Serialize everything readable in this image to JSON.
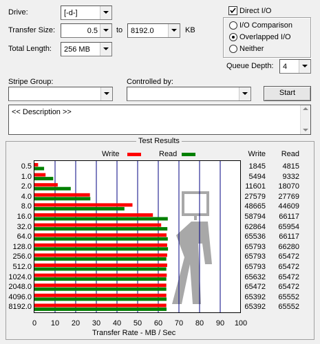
{
  "labels": {
    "drive": "Drive:",
    "transfer_size": "Transfer Size:",
    "to": "to",
    "kb": "KB",
    "total_length": "Total Length:",
    "stripe_group": "Stripe Group:",
    "controlled_by": "Controlled by:",
    "queue_depth": "Queue Depth:",
    "description": "<< Description >>",
    "test_results": "Test Results"
  },
  "fields": {
    "drive": "[-d-]",
    "transfer_size_min": "0.5",
    "transfer_size_max": "8192.0",
    "total_length": "256 MB",
    "stripe_group": "",
    "controlled_by": "",
    "queue_depth": "4"
  },
  "options": {
    "direct_io": "Direct I/O",
    "direct_io_checked": true,
    "io_comparison": "I/O Comparison",
    "overlapped_io": "Overlapped I/O",
    "neither": "Neither",
    "selected": "overlapped_io"
  },
  "buttons": {
    "start": "Start"
  },
  "legend": {
    "write": "Write",
    "read": "Read"
  },
  "columns": {
    "write": "Write",
    "read": "Read"
  },
  "colors": {
    "write": "#ff0000",
    "read": "#008000",
    "grid": "#000080"
  },
  "chart_data": {
    "type": "bar",
    "orientation": "horizontal",
    "title": "Test Results",
    "xlabel": "Transfer Rate - MB / Sec",
    "xlim": [
      0,
      100
    ],
    "xticks": [
      "0",
      "10",
      "20",
      "30",
      "40",
      "50",
      "60",
      "70",
      "80",
      "90",
      "100"
    ],
    "categories": [
      "0.5",
      "1.0",
      "2.0",
      "4.0",
      "8.0",
      "16.0",
      "32.0",
      "64.0",
      "128.0",
      "256.0",
      "512.0",
      "1024.0",
      "2048.0",
      "4096.0",
      "8192.0"
    ],
    "series": [
      {
        "name": "Write",
        "color": "#ff0000",
        "values": [
          1.8,
          5.4,
          11.3,
          26.9,
          47.5,
          57.4,
          61.4,
          64.0,
          64.3,
          64.3,
          64.3,
          64.1,
          63.9,
          63.9,
          63.9
        ]
      },
      {
        "name": "Read",
        "color": "#008000",
        "values": [
          4.7,
          9.1,
          17.6,
          27.1,
          43.6,
          64.6,
          64.4,
          64.6,
          64.7,
          63.9,
          63.9,
          63.9,
          63.9,
          64.0,
          64.0
        ]
      }
    ],
    "write_numbers": [
      "1845",
      "5494",
      "11601",
      "27579",
      "48665",
      "58794",
      "62864",
      "65536",
      "65793",
      "65793",
      "65793",
      "65632",
      "65472",
      "65392",
      "65392"
    ],
    "read_numbers": [
      "4815",
      "9332",
      "18070",
      "27769",
      "44609",
      "66117",
      "65954",
      "66117",
      "66280",
      "65472",
      "65472",
      "65472",
      "65472",
      "65552",
      "65552"
    ],
    "grid": true,
    "legend_position": "top"
  }
}
